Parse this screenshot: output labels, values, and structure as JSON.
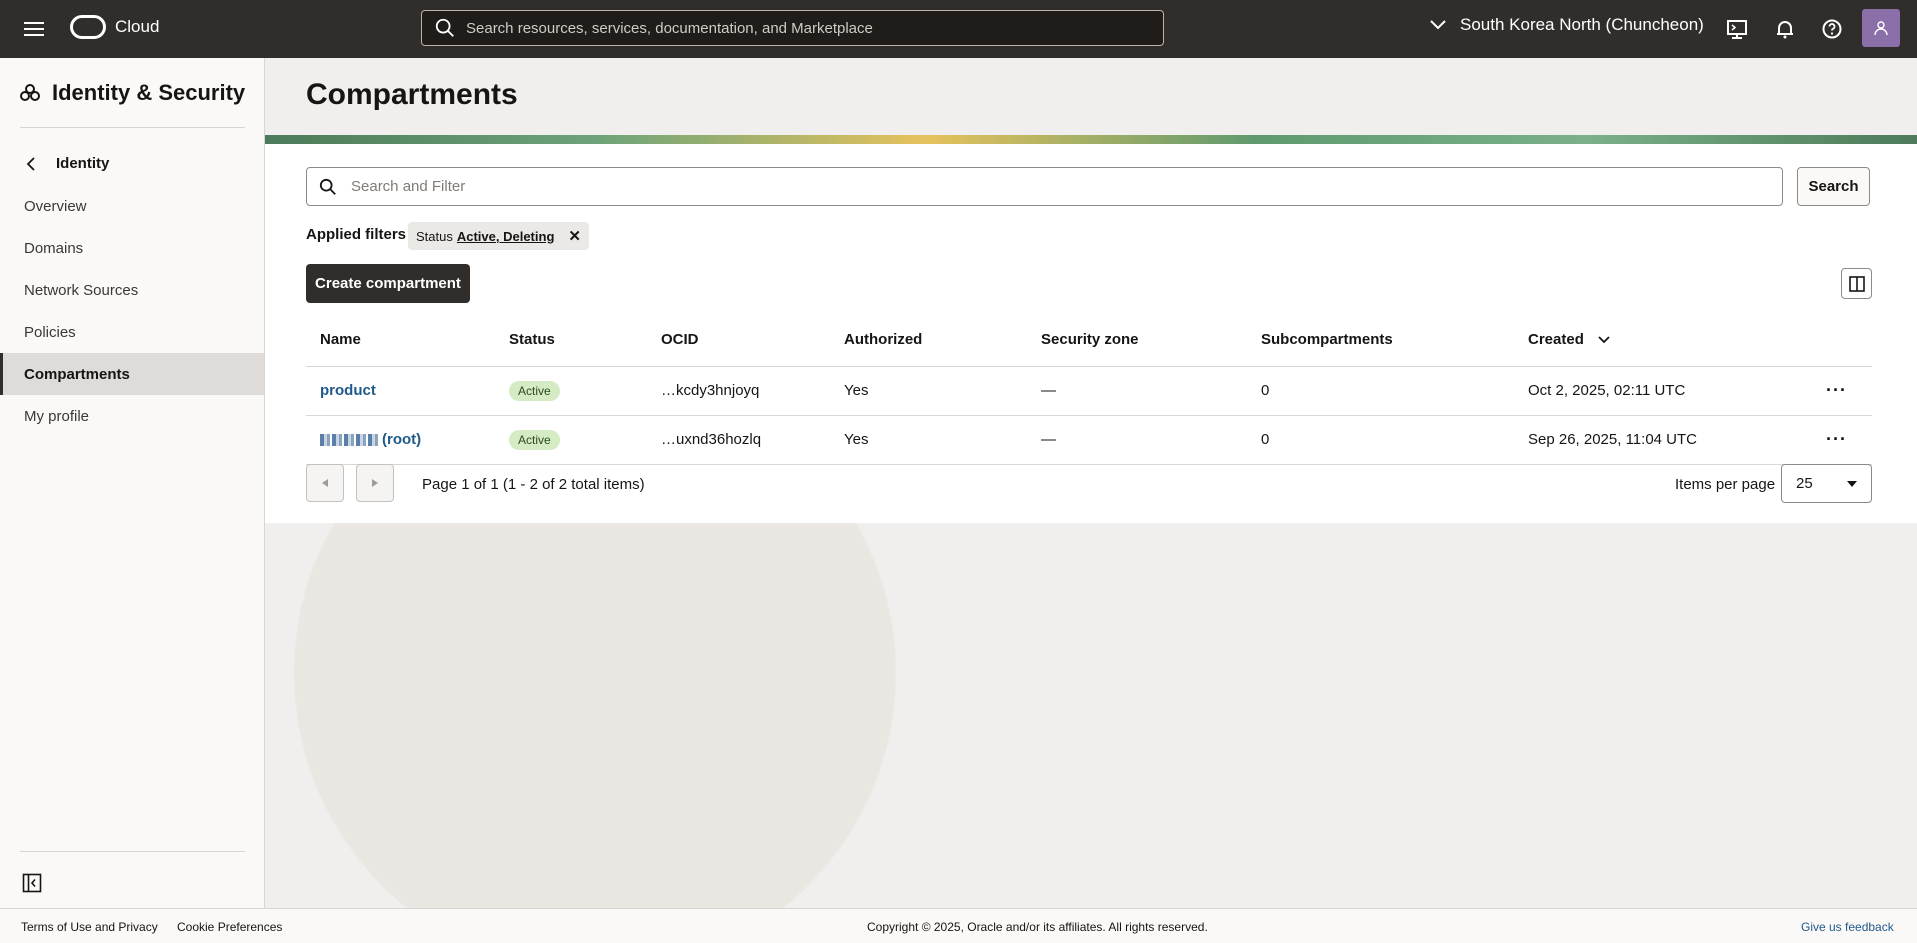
{
  "header": {
    "brand": "Cloud",
    "search_placeholder": "Search resources, services, documentation, and Marketplace",
    "region": "South Korea North (Chuncheon)"
  },
  "sidebar": {
    "title": "Identity & Security",
    "back_label": "Identity",
    "items": [
      {
        "label": "Overview"
      },
      {
        "label": "Domains"
      },
      {
        "label": "Network Sources"
      },
      {
        "label": "Policies"
      },
      {
        "label": "Compartments",
        "active": true
      },
      {
        "label": "My profile"
      }
    ]
  },
  "main": {
    "title": "Compartments",
    "filter_placeholder": "Search and Filter",
    "search_button": "Search",
    "applied_filters_label": "Applied filters",
    "chip": {
      "key": "Status",
      "value": "Active, Deleting"
    },
    "create_button": "Create compartment",
    "table": {
      "headers": [
        "Name",
        "Status",
        "OCID",
        "Authorized",
        "Security zone",
        "Subcompartments",
        "Created"
      ],
      "rows": [
        {
          "name": "product",
          "status": "Active",
          "ocid": "…kcdy3hnjoyq",
          "authorized": "Yes",
          "security_zone": "—",
          "subcompartments": "0",
          "created": "Oct 2, 2025, 02:11 UTC"
        },
        {
          "name": "(root)",
          "status": "Active",
          "ocid": "…uxnd36hozlq",
          "authorized": "Yes",
          "security_zone": "—",
          "subcompartments": "0",
          "created": "Sep 26, 2025, 11:04 UTC"
        }
      ]
    },
    "pager_text": "Page 1 of 1 (1 - 2 of 2 total items)",
    "items_per_page_label": "Items per page",
    "items_per_page": "25"
  },
  "footer": {
    "terms": "Terms of Use and Privacy",
    "cookies": "Cookie Preferences",
    "copyright": "Copyright © 2025, Oracle and/or its affiliates. All rights reserved.",
    "feedback": "Give us feedback"
  }
}
